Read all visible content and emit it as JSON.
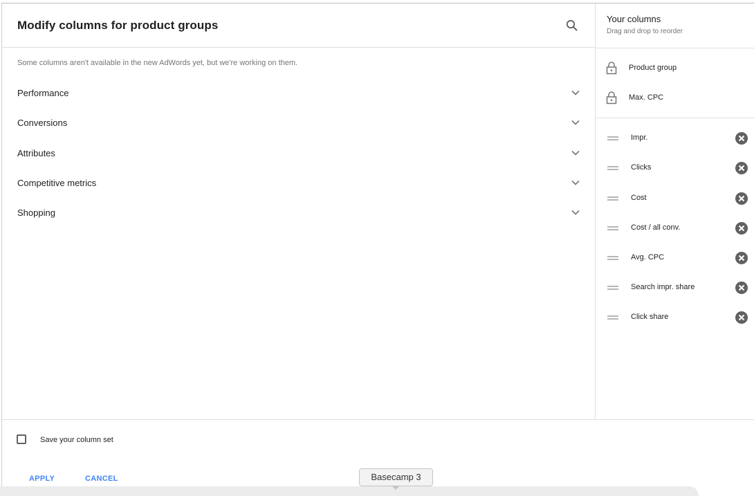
{
  "dialog": {
    "title": "Modify columns for product groups",
    "notice": "Some columns aren't available in the new AdWords yet, but we're working on them.",
    "search_icon": "search-icon",
    "categories": [
      {
        "label": "Performance"
      },
      {
        "label": "Conversions"
      },
      {
        "label": "Attributes"
      },
      {
        "label": "Competitive metrics"
      },
      {
        "label": "Shopping"
      }
    ]
  },
  "your_columns": {
    "title": "Your columns",
    "subtitle": "Drag and drop to reorder",
    "locked": [
      {
        "label": "Product group",
        "icon": "lock-icon"
      },
      {
        "label": "Max. CPC",
        "icon": "lock-icon"
      }
    ],
    "columns": [
      {
        "label": "Impr."
      },
      {
        "label": "Clicks"
      },
      {
        "label": "Cost"
      },
      {
        "label": "Cost / all conv."
      },
      {
        "label": "Avg. CPC"
      },
      {
        "label": "Search impr. share"
      },
      {
        "label": "Click share"
      }
    ]
  },
  "footer": {
    "save_label": "Save your column set",
    "save_checked": false,
    "apply_label": "APPLY",
    "cancel_label": "CANCEL"
  },
  "tooltip": {
    "text": "Basecamp 3"
  },
  "colors": {
    "accent": "#4285f4",
    "icon_gray": "#757575",
    "remove_icon": "#616161"
  }
}
